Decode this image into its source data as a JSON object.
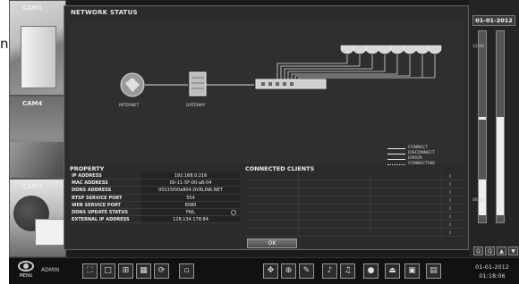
{
  "fragment_text": "n.",
  "cameras": [
    {
      "label": "CAM1"
    },
    {
      "label": "CAM4"
    },
    {
      "label": "CAM7"
    }
  ],
  "dialog": {
    "title": "NETWORK STATUS",
    "diagram": {
      "internet_label": "INTERNET",
      "gateway_label": "GATEWAY",
      "legend": [
        {
          "label": "CONNECT",
          "style": "solid"
        },
        {
          "label": "DISCONNECT",
          "style": "solid"
        },
        {
          "label": "ERROR",
          "style": "solid"
        },
        {
          "label": "CONNECTING",
          "style": "dotted"
        }
      ]
    },
    "property": {
      "header": "PROPERTY",
      "rows": [
        {
          "key": "IP ADDRESS",
          "value": "192.168.0.216"
        },
        {
          "key": "MAC ADDRESS",
          "value": "00-11-5F-00-a8-04"
        },
        {
          "key": "DDNS ADDRESS",
          "value": "00115f00a804.DVRLINK.NET"
        },
        {
          "key": "RTSP SERVICE PORT",
          "value": "554"
        },
        {
          "key": "WEB SERVICE PORT",
          "value": "8080"
        },
        {
          "key": "DDNS UPDATE STATUS",
          "value": "FAIL"
        },
        {
          "key": "EXTERNAL IP ADDRESS",
          "value": "128.134.178.84"
        }
      ]
    },
    "clients": {
      "header": "CONNECTED CLIENTS",
      "row_button": "X"
    },
    "ok_label": "OK"
  },
  "right_panel": {
    "date": "01-01-2012",
    "ticks": [
      "12:00",
      "06:00"
    ],
    "buttons": [
      "Q",
      "Q",
      "▲",
      "▼"
    ]
  },
  "bottom_bar": {
    "menu_label": "MENU",
    "user_label": "ADMIN",
    "datetime_date": "01-01-2012",
    "datetime_time": "01:18:06"
  }
}
